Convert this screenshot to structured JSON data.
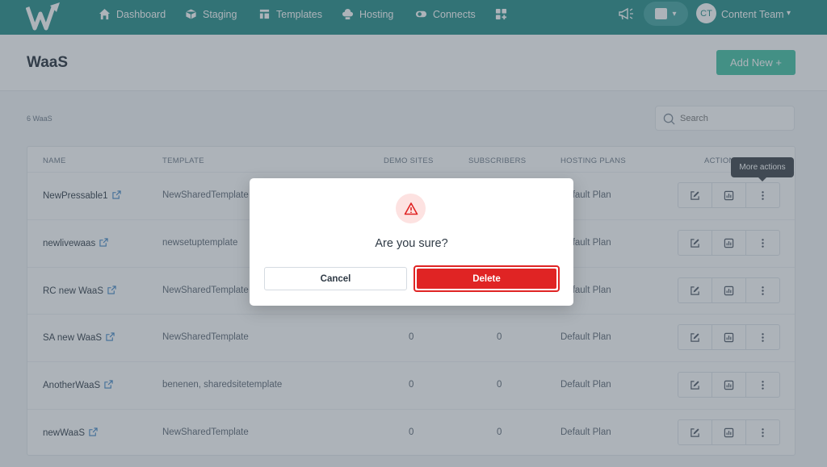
{
  "nav": {
    "items": [
      {
        "label": "Dashboard",
        "icon": "home-icon"
      },
      {
        "label": "Staging",
        "icon": "cube-icon"
      },
      {
        "label": "Templates",
        "icon": "layout-icon"
      },
      {
        "label": "Hosting",
        "icon": "cloud-server-icon"
      },
      {
        "label": "Connects",
        "icon": "toggle-link-icon"
      }
    ],
    "apps_icon": "apps-grid-icon",
    "notifications_icon": "megaphone-icon",
    "stats_icon": "bar-chart-icon",
    "user": {
      "initials": "CT",
      "name": "Content Team"
    }
  },
  "page": {
    "title": "WaaS",
    "add_button": "Add New +",
    "count_label": "6 WaaS",
    "search_placeholder": "Search"
  },
  "table": {
    "headers": {
      "name": "NAME",
      "template": "TEMPLATE",
      "demo_sites": "DEMO SITES",
      "subscribers": "SUBSCRIBERS",
      "hosting_plans": "HOSTING PLANS",
      "actions": "ACTIONS"
    },
    "rows": [
      {
        "name": "NewPressable1",
        "template": "NewSharedTemplate",
        "demo_sites": "",
        "subscribers": "",
        "plan": "Default Plan"
      },
      {
        "name": "newlivewaas",
        "template": "newsetuptemplate",
        "demo_sites": "",
        "subscribers": "",
        "plan": "Default Plan"
      },
      {
        "name": "RC new WaaS",
        "template": "NewSharedTemplate",
        "demo_sites": "",
        "subscribers": "",
        "plan": "Default Plan"
      },
      {
        "name": "SA new WaaS",
        "template": "NewSharedTemplate",
        "demo_sites": "0",
        "subscribers": "0",
        "plan": "Default Plan"
      },
      {
        "name": "AnotherWaaS",
        "template": "benenen, sharedsitetemplate",
        "demo_sites": "0",
        "subscribers": "0",
        "plan": "Default Plan"
      },
      {
        "name": "newWaaS",
        "template": "NewSharedTemplate",
        "demo_sites": "0",
        "subscribers": "0",
        "plan": "Default Plan"
      }
    ]
  },
  "tooltip": "More actions",
  "modal": {
    "title": "Are you sure?",
    "cancel_label": "Cancel",
    "delete_label": "Delete",
    "icon": "warning-triangle-icon",
    "accent": "#e02424"
  },
  "colors": {
    "topbar": "#1f8a86",
    "primary_button": "#3fbfa0",
    "danger": "#e02424"
  }
}
